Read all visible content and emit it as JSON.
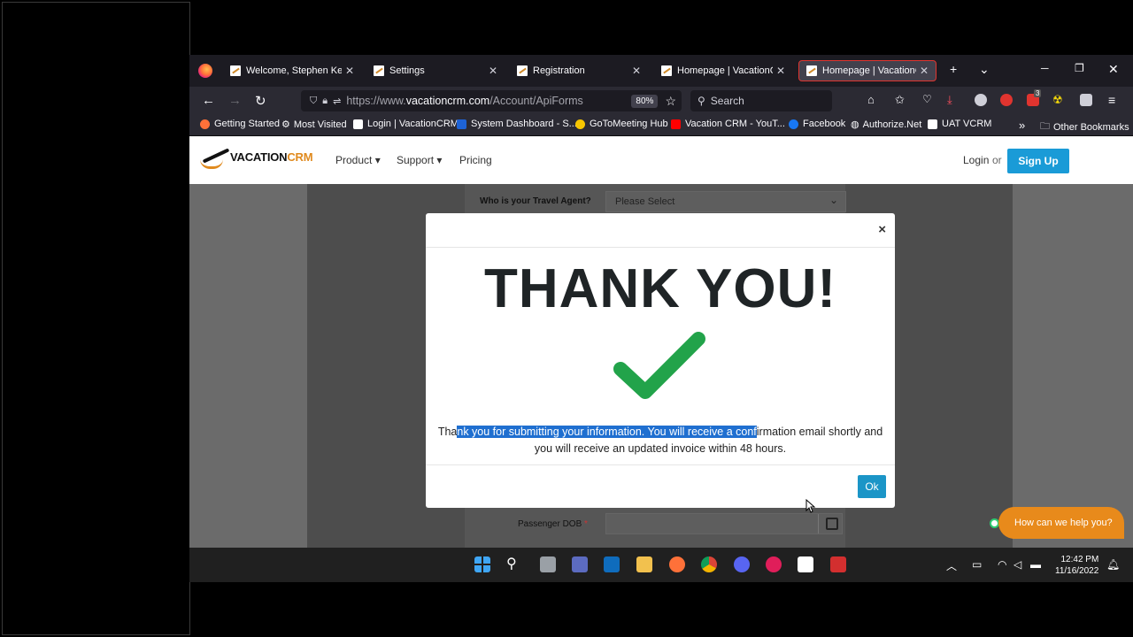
{
  "browser": {
    "tabs": [
      {
        "title": "Welcome, Stephen Kelly",
        "active": false
      },
      {
        "title": "Settings",
        "active": false
      },
      {
        "title": "Registration",
        "active": false
      },
      {
        "title": "Homepage | VacationCRM",
        "active": false
      },
      {
        "title": "Homepage | VacationCRM",
        "active": true
      }
    ],
    "url_prefix": "https://www.",
    "url_domain": "vacationcrm.com",
    "url_path": "/Account/ApiForms",
    "zoom": "80%",
    "search_placeholder": "Search",
    "notification_badge": "3",
    "bookmarks": [
      "Getting Started",
      "Most Visited",
      "Login | VacationCRM",
      "System Dashboard - S...",
      "GoToMeeting Hub",
      "Vacation CRM - YouT...",
      "Facebook",
      "Authorize.Net",
      "UAT VCRM",
      "Other Bookmarks"
    ]
  },
  "site": {
    "logo_main": "VACATION",
    "logo_accent": "CRM",
    "nav": [
      "Product ▾",
      "Support ▾",
      "Pricing"
    ],
    "login": "Login",
    "or": "or",
    "signup": "Sign Up"
  },
  "form": {
    "travel_agent_label": "Who is your Travel Agent?",
    "travel_agent_value": "Please Select",
    "dob_label": "Passenger DOB",
    "dob_required": "*"
  },
  "modal": {
    "heading": "THANK YOU!",
    "close": "×",
    "msg_pre": "Tha",
    "msg_highlight": "nk you for submitting your information. You will receive a conf",
    "msg_post": "irmation email shortly and you will receive an updated invoice within 48 hours.",
    "ok": "Ok"
  },
  "chat": {
    "label": "How can we help you?"
  },
  "taskbar": {
    "time": "12:42 PM",
    "date": "11/16/2022"
  },
  "colors": {
    "accent": "#1a9bd7",
    "brand_orange": "#e08a1e",
    "check_green": "#22a34a"
  }
}
